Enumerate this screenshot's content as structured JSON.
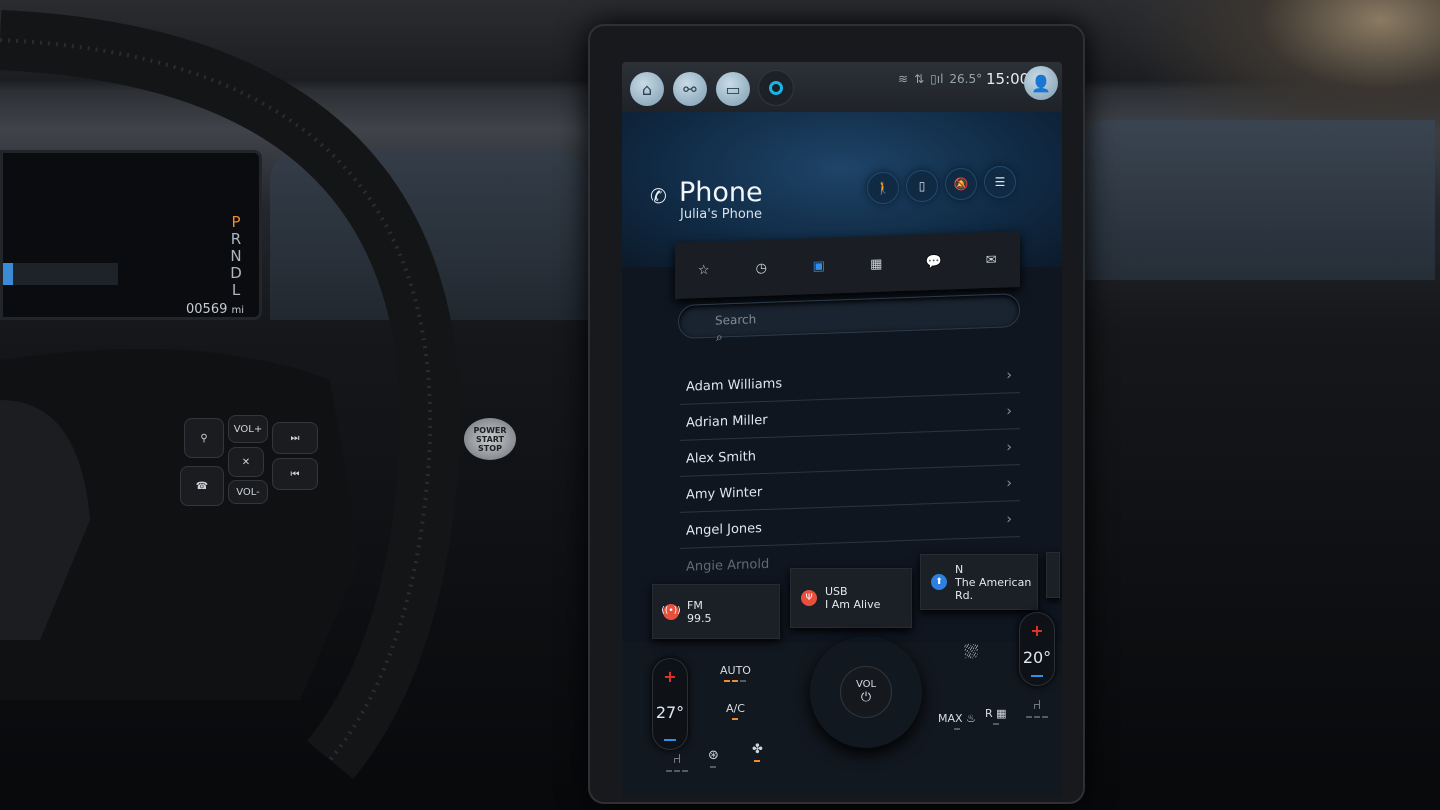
{
  "cluster": {
    "gears": [
      "P",
      "R",
      "N",
      "D",
      "L"
    ],
    "active_gear": "P",
    "odometer": "00569",
    "odometer_unit": "mi"
  },
  "steering": {
    "vol_up": "VOL+",
    "vol_down": "VOL-",
    "power": [
      "POWER",
      "START",
      "STOP"
    ]
  },
  "topbar": {
    "icons": [
      "home-icon",
      "connect-icon",
      "camera-icon",
      "alexa-icon"
    ],
    "temperature": "26.5°",
    "time": "15:00",
    "status_icons": [
      "wifi-icon",
      "data-4g-icon",
      "phone-signal-icon"
    ]
  },
  "header": {
    "title": "Phone",
    "subtitle": "Julia's Phone",
    "actions": [
      "driving-icon",
      "phone-device-icon",
      "mute-bell-icon",
      "settings-sliders-icon"
    ]
  },
  "tabs": [
    {
      "name": "favorites",
      "icon": "☆"
    },
    {
      "name": "recents",
      "icon": "◷"
    },
    {
      "name": "contacts",
      "icon": "▣",
      "active": true
    },
    {
      "name": "keypad",
      "icon": "▦"
    },
    {
      "name": "messages",
      "icon": "💬"
    },
    {
      "name": "email",
      "icon": "✉"
    }
  ],
  "search": {
    "placeholder": "Search"
  },
  "contacts": [
    "Adam Williams",
    "Adrian Miller",
    "Alex Smith",
    "Amy Winter",
    "Angel Jones",
    "Angie Arnold"
  ],
  "media_cards": [
    {
      "label": "FM",
      "value": "99.5",
      "color": "#e8503e"
    },
    {
      "label": "USB",
      "value": "I Am Alive",
      "color": "#e8503e"
    },
    {
      "label": "N",
      "value": "The American Rd.",
      "color": "#2e7fe0"
    }
  ],
  "climate": {
    "driver_temp": "27°",
    "passenger_temp": "20°",
    "auto": "AUTO",
    "ac": "A/C",
    "knob": "VOL",
    "max_defrost": "MAX",
    "rear_defrost": "R"
  },
  "colors": {
    "accent": "#2f8fe8",
    "increase": "#e8322e",
    "active_indicator": "#f08a2e"
  }
}
